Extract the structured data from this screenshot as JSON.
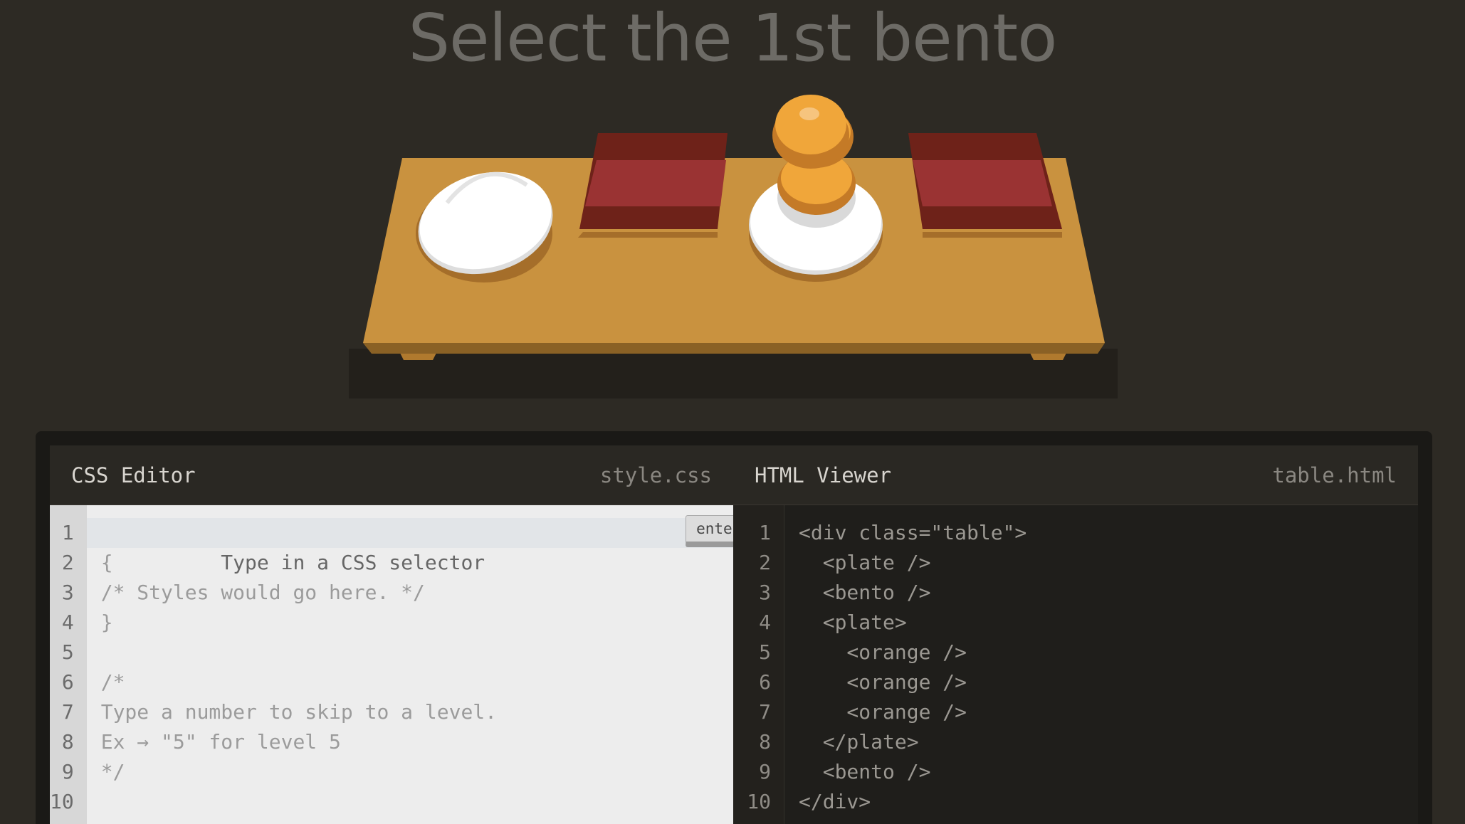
{
  "title": "Select the 1st bento",
  "css_editor": {
    "title": "CSS Editor",
    "filename": "style.css",
    "line_numbers": [
      "1",
      "2",
      "3",
      "4",
      "5",
      "6",
      "7",
      "8",
      "9",
      "10"
    ],
    "placeholder": "Type in a CSS selector",
    "enter_label": "enter",
    "lines": [
      "{",
      "/* Styles would go here. */",
      "}",
      "",
      "/*",
      "Type a number to skip to a level.",
      "Ex → \"5\" for level 5",
      "*/",
      ""
    ]
  },
  "html_viewer": {
    "title": "HTML Viewer",
    "filename": "table.html",
    "line_numbers": [
      "1",
      "2",
      "3",
      "4",
      "5",
      "6",
      "7",
      "8",
      "9",
      "10"
    ],
    "lines": [
      "<div class=\"table\">",
      "  <plate />",
      "  <bento />",
      "  <plate>",
      "    <orange />",
      "    <orange />",
      "    <orange />",
      "  </plate>",
      "  <bento />",
      "</div>"
    ]
  },
  "colors": {
    "background": "#2d2a24",
    "table": "#c9923f",
    "bento": "#9a3333",
    "plate": "#ffffff",
    "orange": "#f0a63a"
  }
}
